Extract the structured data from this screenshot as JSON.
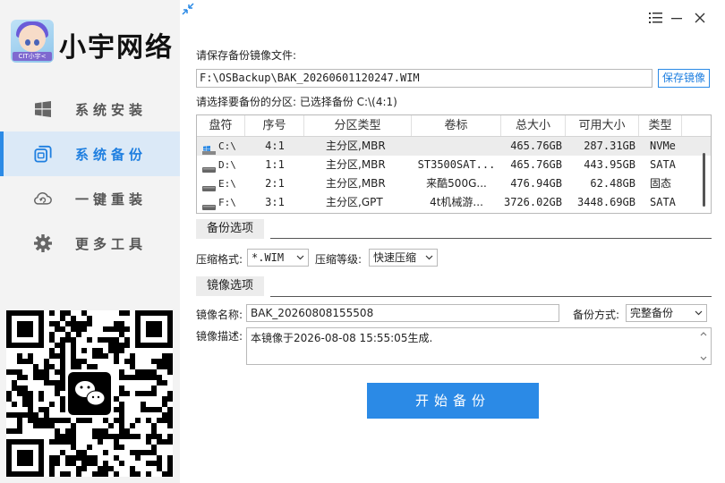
{
  "brand": {
    "name": "小宇网络",
    "logo_tag": "CIT小宇<"
  },
  "nav": [
    {
      "label": "系统安装",
      "icon": "windows-icon",
      "active": false
    },
    {
      "label": "系统备份",
      "icon": "copy-icon",
      "active": true
    },
    {
      "label": "一键重装",
      "icon": "cloud-refresh-icon",
      "active": false
    },
    {
      "label": "更多工具",
      "icon": "gear-icon",
      "active": false
    }
  ],
  "save_file": {
    "label": "请保存备份镜像文件:",
    "path": "F:\\OSBackup\\BAK_20260601120247.WIM",
    "button": "保存镜像"
  },
  "partition": {
    "label": "请选择要备份的分区: 已选择备份 C:\\(4:1)",
    "columns": [
      "盘符",
      "序号",
      "分区类型",
      "卷标",
      "总大小",
      "可用大小",
      "类型"
    ],
    "rows": [
      {
        "drive": "C:\\",
        "index": "4:1",
        "part_type": "主分区,MBR",
        "volume": "",
        "total": "465.76GB",
        "free": "287.31GB",
        "kind": "NVMe",
        "selected": true,
        "icon": "windows-drive-icon"
      },
      {
        "drive": "D:\\",
        "index": "1:1",
        "part_type": "主分区,MBR",
        "volume": "ST3500SAT...",
        "total": "465.76GB",
        "free": "443.95GB",
        "kind": "SATA",
        "selected": false,
        "icon": "drive-icon"
      },
      {
        "drive": "E:\\",
        "index": "2:1",
        "part_type": "主分区,MBR",
        "volume": "来酷500G...",
        "total": "476.94GB",
        "free": "62.48GB",
        "kind": "固态",
        "selected": false,
        "icon": "drive-icon"
      },
      {
        "drive": "F:\\",
        "index": "3:1",
        "part_type": "主分区,GPT",
        "volume": "4t机械游...",
        "total": "3726.02GB",
        "free": "3448.69GB",
        "kind": "SATA",
        "selected": false,
        "icon": "drive-icon"
      }
    ]
  },
  "backup_options": {
    "section": "备份选项",
    "format_label": "压缩格式:",
    "format_value": "*.WIM",
    "level_label": "压缩等级:",
    "level_value": "快速压缩"
  },
  "image_options": {
    "section": "镜像选项",
    "name_label": "镜像名称:",
    "name_value": "BAK_20260808155508",
    "mode_label": "备份方式:",
    "mode_value": "完整备份",
    "desc_label": "镜像描述:",
    "desc_value": "本镜像于2026-08-08 15:55:05生成."
  },
  "start_button": "开始备份",
  "colors": {
    "accent": "#2b8ae6",
    "sidebar_bg": "#f3f3f3",
    "active_bg": "#dbe9f7"
  }
}
